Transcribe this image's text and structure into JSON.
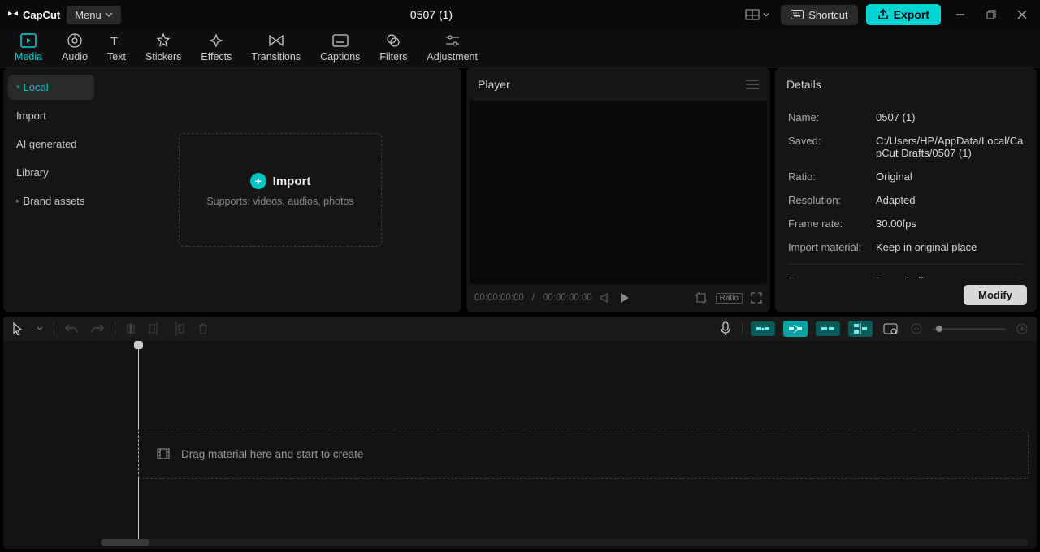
{
  "titlebar": {
    "logo_text": "CapCut",
    "menu_label": "Menu",
    "project_title": "0507 (1)",
    "shortcut_label": "Shortcut",
    "export_label": "Export"
  },
  "top_tabs": [
    {
      "label": "Media",
      "icon": "media"
    },
    {
      "label": "Audio",
      "icon": "audio"
    },
    {
      "label": "Text",
      "icon": "text"
    },
    {
      "label": "Stickers",
      "icon": "stickers"
    },
    {
      "label": "Effects",
      "icon": "effects"
    },
    {
      "label": "Transitions",
      "icon": "transitions"
    },
    {
      "label": "Captions",
      "icon": "captions"
    },
    {
      "label": "Filters",
      "icon": "filters"
    },
    {
      "label": "Adjustment",
      "icon": "adjustment"
    }
  ],
  "media_sidebar": [
    {
      "label": "Local",
      "active": true,
      "caret": "▾"
    },
    {
      "label": "Import"
    },
    {
      "label": "AI generated"
    },
    {
      "label": "Library"
    },
    {
      "label": "Brand assets",
      "caret": "▸"
    }
  ],
  "import_box": {
    "label": "Import",
    "sub": "Supports: videos, audios, photos"
  },
  "player": {
    "header": "Player",
    "time_current": "00:00:00:00",
    "time_total": "00:00:00:00",
    "ratio_chip": "Ratio"
  },
  "details": {
    "header": "Details",
    "rows": [
      {
        "label": "Name:",
        "value": "0507 (1)"
      },
      {
        "label": "Saved:",
        "value": "C:/Users/HP/AppData/Local/CapCut Drafts/0507 (1)"
      },
      {
        "label": "Ratio:",
        "value": "Original"
      },
      {
        "label": "Resolution:",
        "value": "Adapted"
      },
      {
        "label": "Frame rate:",
        "value": "30.00fps"
      },
      {
        "label": "Import material:",
        "value": "Keep in original place"
      }
    ],
    "proxy_label": "Proxy:",
    "proxy_value": "Turned off",
    "modify_label": "Modify"
  },
  "timeline": {
    "drop_hint": "Drag material here and start to create"
  }
}
